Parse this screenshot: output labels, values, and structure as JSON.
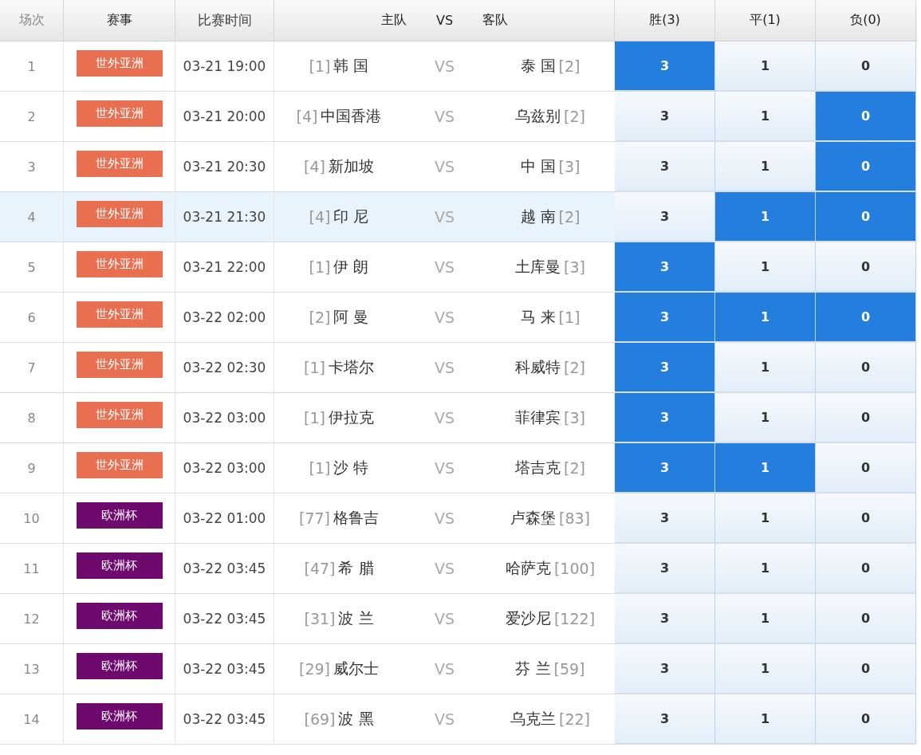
{
  "columns": [
    "场次",
    "赛事",
    "比赛时间",
    "主队",
    "VS",
    "客队",
    "胜(3)",
    "平(1)",
    "负(0)"
  ],
  "rows": [
    {
      "no": "1",
      "league": "世外亚洲",
      "color": "#e87050",
      "time": "03-21 19:00",
      "home_rank": "[1]",
      "home": "韩 国",
      "vs": "VS",
      "away": "泰 国",
      "away_rank": "[2]",
      "highlighted": false,
      "odds": [
        {
          "value": "3",
          "selected": true
        },
        {
          "value": "1",
          "selected": false
        },
        {
          "value": "0",
          "selected": false
        }
      ]
    },
    {
      "no": "2",
      "league": "世外亚洲",
      "color": "#e87050",
      "time": "03-21 20:00",
      "home_rank": "[4]",
      "home": "中国香港",
      "vs": "VS",
      "away": "乌兹别",
      "away_rank": "[2]",
      "highlighted": false,
      "odds": [
        {
          "value": "3",
          "selected": false
        },
        {
          "value": "1",
          "selected": false
        },
        {
          "value": "0",
          "selected": true
        }
      ]
    },
    {
      "no": "3",
      "league": "世外亚洲",
      "color": "#e87050",
      "time": "03-21 20:30",
      "home_rank": "[4]",
      "home": "新加坡",
      "vs": "VS",
      "away": "中 国",
      "away_rank": "[3]",
      "highlighted": false,
      "odds": [
        {
          "value": "3",
          "selected": false
        },
        {
          "value": "1",
          "selected": false
        },
        {
          "value": "0",
          "selected": true
        }
      ]
    },
    {
      "no": "4",
      "league": "世外亚洲",
      "color": "#e87050",
      "time": "03-21 21:30",
      "home_rank": "[4]",
      "home": "印 尼",
      "vs": "VS",
      "away": "越 南",
      "away_rank": "[2]",
      "highlighted": true,
      "odds": [
        {
          "value": "3",
          "selected": false
        },
        {
          "value": "1",
          "selected": true
        },
        {
          "value": "0",
          "selected": true
        }
      ]
    },
    {
      "no": "5",
      "league": "世外亚洲",
      "color": "#e87050",
      "time": "03-21 22:00",
      "home_rank": "[1]",
      "home": "伊 朗",
      "vs": "VS",
      "away": "土库曼",
      "away_rank": "[3]",
      "highlighted": false,
      "odds": [
        {
          "value": "3",
          "selected": true
        },
        {
          "value": "1",
          "selected": false
        },
        {
          "value": "0",
          "selected": false
        }
      ]
    },
    {
      "no": "6",
      "league": "世外亚洲",
      "color": "#e87050",
      "time": "03-22 02:00",
      "home_rank": "[2]",
      "home": "阿 曼",
      "vs": "VS",
      "away": "马 来",
      "away_rank": "[1]",
      "highlighted": false,
      "odds": [
        {
          "value": "3",
          "selected": true
        },
        {
          "value": "1",
          "selected": true
        },
        {
          "value": "0",
          "selected": true
        }
      ]
    },
    {
      "no": "7",
      "league": "世外亚洲",
      "color": "#e87050",
      "time": "03-22 02:30",
      "home_rank": "[1]",
      "home": "卡塔尔",
      "vs": "VS",
      "away": "科威特",
      "away_rank": "[2]",
      "highlighted": false,
      "odds": [
        {
          "value": "3",
          "selected": true
        },
        {
          "value": "1",
          "selected": false
        },
        {
          "value": "0",
          "selected": false
        }
      ]
    },
    {
      "no": "8",
      "league": "世外亚洲",
      "color": "#e87050",
      "time": "03-22 03:00",
      "home_rank": "[1]",
      "home": "伊拉克",
      "vs": "VS",
      "away": "菲律宾",
      "away_rank": "[3]",
      "highlighted": false,
      "odds": [
        {
          "value": "3",
          "selected": true
        },
        {
          "value": "1",
          "selected": false
        },
        {
          "value": "0",
          "selected": false
        }
      ]
    },
    {
      "no": "9",
      "league": "世外亚洲",
      "color": "#e87050",
      "time": "03-22 03:00",
      "home_rank": "[1]",
      "home": "沙 特",
      "vs": "VS",
      "away": "塔吉克",
      "away_rank": "[2]",
      "highlighted": false,
      "odds": [
        {
          "value": "3",
          "selected": true
        },
        {
          "value": "1",
          "selected": true
        },
        {
          "value": "0",
          "selected": false
        }
      ]
    },
    {
      "no": "10",
      "league": "欧洲杯",
      "color": "#6e0a6e",
      "time": "03-22 01:00",
      "home_rank": "[77]",
      "home": "格鲁吉",
      "vs": "VS",
      "away": "卢森堡",
      "away_rank": "[83]",
      "highlighted": false,
      "odds": [
        {
          "value": "3",
          "selected": false
        },
        {
          "value": "1",
          "selected": false
        },
        {
          "value": "0",
          "selected": false
        }
      ]
    },
    {
      "no": "11",
      "league": "欧洲杯",
      "color": "#6e0a6e",
      "time": "03-22 03:45",
      "home_rank": "[47]",
      "home": "希 腊",
      "vs": "VS",
      "away": "哈萨克",
      "away_rank": "[100]",
      "highlighted": false,
      "odds": [
        {
          "value": "3",
          "selected": false
        },
        {
          "value": "1",
          "selected": false
        },
        {
          "value": "0",
          "selected": false
        }
      ]
    },
    {
      "no": "12",
      "league": "欧洲杯",
      "color": "#6e0a6e",
      "time": "03-22 03:45",
      "home_rank": "[31]",
      "home": "波 兰",
      "vs": "VS",
      "away": "爱沙尼",
      "away_rank": "[122]",
      "highlighted": false,
      "odds": [
        {
          "value": "3",
          "selected": false
        },
        {
          "value": "1",
          "selected": false
        },
        {
          "value": "0",
          "selected": false
        }
      ]
    },
    {
      "no": "13",
      "league": "欧洲杯",
      "color": "#6e0a6e",
      "time": "03-22 03:45",
      "home_rank": "[29]",
      "home": "威尔士",
      "vs": "VS",
      "away": "芬 兰",
      "away_rank": "[59]",
      "highlighted": false,
      "odds": [
        {
          "value": "3",
          "selected": false
        },
        {
          "value": "1",
          "selected": false
        },
        {
          "value": "0",
          "selected": false
        }
      ]
    },
    {
      "no": "14",
      "league": "欧洲杯",
      "color": "#6e0a6e",
      "time": "03-22 03:45",
      "home_rank": "[69]",
      "home": "波 黑",
      "vs": "VS",
      "away": "乌克兰",
      "away_rank": "[22]",
      "highlighted": false,
      "odds": [
        {
          "value": "3",
          "selected": false
        },
        {
          "value": "1",
          "selected": false
        },
        {
          "value": "0",
          "selected": false
        }
      ]
    }
  ]
}
